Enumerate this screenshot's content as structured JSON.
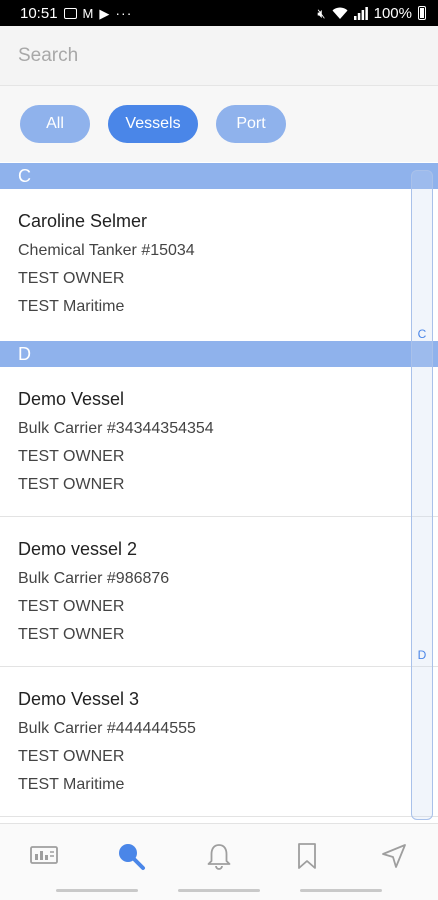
{
  "status_bar": {
    "time": "10:51",
    "more": "···",
    "battery": "100%"
  },
  "search": {
    "placeholder": "Search"
  },
  "filters": [
    {
      "label": "All"
    },
    {
      "label": "Vessels"
    },
    {
      "label": "Port"
    }
  ],
  "colors": {
    "accent": "#4a86e8",
    "chip_inactive": "#8fb2ec",
    "section_header": "#8fb2ec"
  },
  "sections": [
    {
      "letter": "C",
      "items": [
        {
          "name": "Caroline Selmer",
          "type": "Chemical Tanker #15034",
          "owner": "TEST OWNER",
          "manager": "TEST Maritime"
        }
      ]
    },
    {
      "letter": "D",
      "items": [
        {
          "name": "Demo Vessel",
          "type": "Bulk Carrier #34344354354",
          "owner": "TEST OWNER",
          "manager": "TEST OWNER"
        },
        {
          "name": "Demo vessel 2",
          "type": "Bulk Carrier #986876",
          "owner": "TEST OWNER",
          "manager": "TEST OWNER"
        },
        {
          "name": "Demo Vessel 3",
          "type": "Bulk Carrier #444444555",
          "owner": "TEST OWNER",
          "manager": "TEST Maritime"
        }
      ]
    }
  ],
  "index": [
    "C",
    "D"
  ],
  "nav": [
    {
      "icon": "dashboard-icon"
    },
    {
      "icon": "search-icon"
    },
    {
      "icon": "bell-icon"
    },
    {
      "icon": "bookmark-icon"
    },
    {
      "icon": "navigation-arrow-icon"
    }
  ]
}
